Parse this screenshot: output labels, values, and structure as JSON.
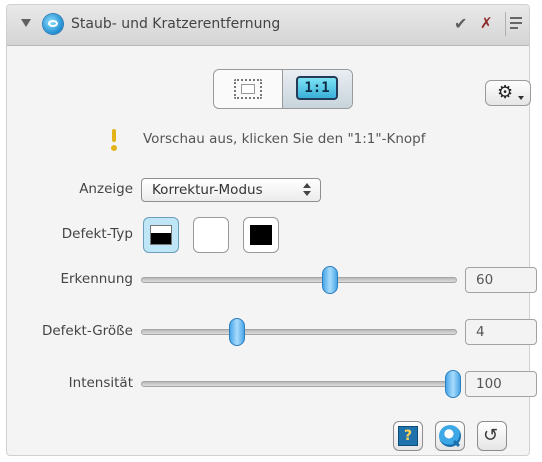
{
  "titlebar": {
    "title": "Staub- und Kratzerentfernung",
    "collapse_icon": "disclosure-triangle-icon",
    "logo_icon": "filter-logo-icon",
    "confirm_icon": "checkmark-icon",
    "close_icon": "close-icon",
    "menu_icon": "panel-menu-icon"
  },
  "preview_toggle": {
    "left_icon": "show-frame-icon",
    "right_label": "1:1",
    "selected": "1:1"
  },
  "settings_button": {
    "icon": "gear-icon",
    "caret": "dropdown-caret-icon"
  },
  "warning": {
    "icon": "exclamation-icon",
    "text": "Vorschau aus, klicken Sie den \"1:1\"-Knopf"
  },
  "anzeige": {
    "label": "Anzeige",
    "value": "Korrektur-Modus"
  },
  "defekt_typ": {
    "label": "Defekt-Typ",
    "options": [
      {
        "icon": "dark-defect-on-light-icon",
        "selected": true
      },
      {
        "icon": "white-defect-icon",
        "selected": false
      },
      {
        "icon": "black-defect-icon",
        "selected": false
      }
    ]
  },
  "sliders": [
    {
      "label": "Erkennung",
      "value": "60",
      "fraction": 0.6
    },
    {
      "label": "Defekt-Größe",
      "value": "4",
      "fraction": 0.3
    },
    {
      "label": "Intensität",
      "value": "100",
      "fraction": 1.0
    }
  ],
  "bottom_buttons": [
    {
      "icon": "help-icon",
      "glyph": "?"
    },
    {
      "icon": "preview-icon"
    },
    {
      "icon": "reset-icon",
      "glyph": "↺"
    }
  ],
  "colors": {
    "accent": "#4aa6e8",
    "selected_button": "#bfe6f7",
    "warning": "#e3b31a"
  }
}
